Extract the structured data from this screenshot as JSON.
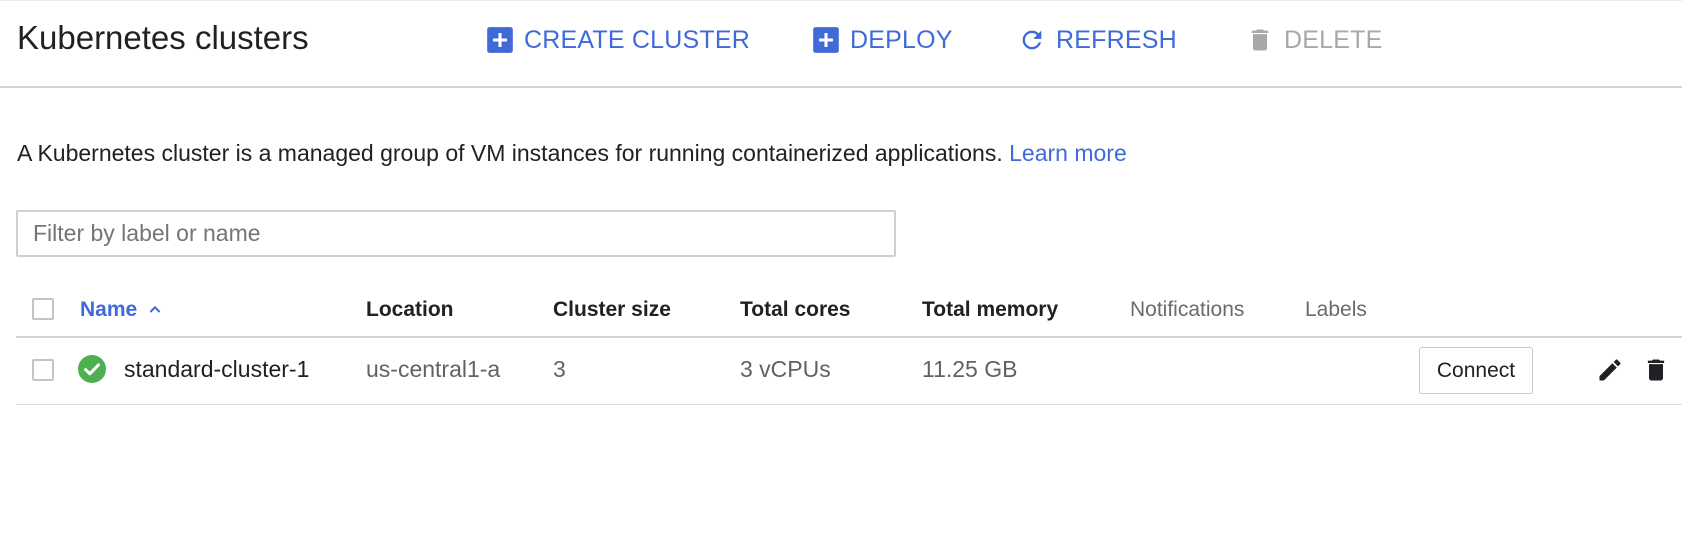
{
  "header": {
    "title": "Kubernetes clusters",
    "actions": {
      "create": "CREATE CLUSTER",
      "deploy": "DEPLOY",
      "refresh": "REFRESH",
      "delete": "DELETE"
    },
    "accent_color": "#3f6ad8",
    "disabled_color": "#a8a8a8"
  },
  "description": {
    "text": "A Kubernetes cluster is a managed group of VM instances for running containerized applications.",
    "link": "Learn more"
  },
  "filter": {
    "placeholder": "Filter by label or name",
    "value": ""
  },
  "table": {
    "columns": {
      "name": "Name",
      "location": "Location",
      "size": "Cluster size",
      "cores": "Total cores",
      "memory": "Total memory",
      "notifications": "Notifications",
      "labels": "Labels"
    },
    "sort": {
      "column": "name",
      "direction": "ascending",
      "icon": "chevron-up-icon"
    },
    "rows": [
      {
        "status": "ok",
        "status_icon": "check-circle-icon",
        "status_color": "#4caf50",
        "name": "standard-cluster-1",
        "location": "us-central1-a",
        "size": "3",
        "cores": "3 vCPUs",
        "memory": "11.25 GB",
        "notifications": "",
        "labels": "",
        "connect": "Connect"
      }
    ]
  }
}
